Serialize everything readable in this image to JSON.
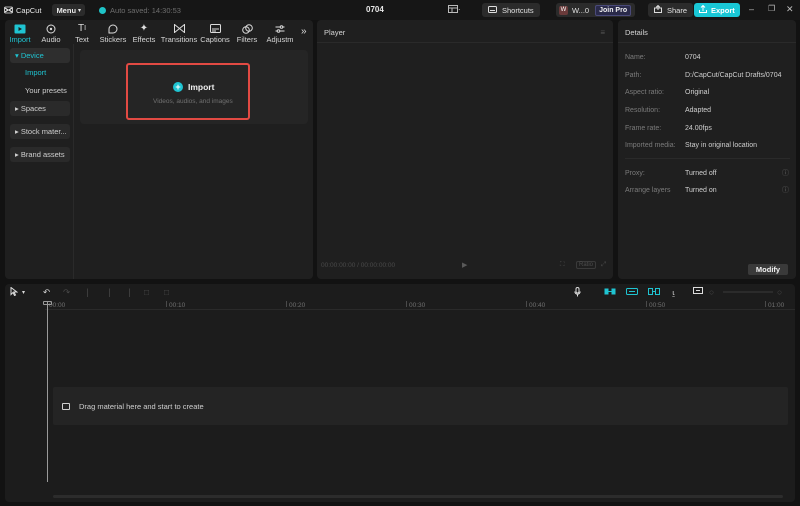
{
  "titlebar": {
    "app_name": "CapCut",
    "menu_label": "Menu",
    "autosave": "Auto saved: 14:30:53",
    "project_title": "0704",
    "shortcuts_label": "Shortcuts",
    "workspace_initial": "W",
    "workspace_name": "W...0",
    "join_pro_label": "Join Pro",
    "share_label": "Share",
    "export_label": "Export"
  },
  "tool_tabs": [
    {
      "label": "Import",
      "icon": "import-icon",
      "active": true
    },
    {
      "label": "Audio",
      "icon": "audio-icon"
    },
    {
      "label": "Text",
      "icon": "text-icon"
    },
    {
      "label": "Stickers",
      "icon": "stickers-icon"
    },
    {
      "label": "Effects",
      "icon": "effects-icon"
    },
    {
      "label": "Transitions",
      "icon": "transitions-icon"
    },
    {
      "label": "Captions",
      "icon": "captions-icon"
    },
    {
      "label": "Filters",
      "icon": "filters-icon"
    },
    {
      "label": "Adjustm",
      "icon": "adjustment-icon"
    }
  ],
  "sidebar": {
    "device": "▾ Device",
    "import": "Import",
    "your_presets": "Your presets",
    "spaces": "▸ Spaces",
    "stock_material": "▸ Stock mater...",
    "brand_assets": "▸ Brand assets"
  },
  "import_area": {
    "button_label": "Import",
    "subtitle": "Videos, audios, and images"
  },
  "player": {
    "title": "Player",
    "timecode": "00:00:00:00 / 00:00:00:00",
    "ratio_label": "Ratio"
  },
  "details": {
    "title": "Details",
    "rows": [
      {
        "label": "Name:",
        "value": "0704"
      },
      {
        "label": "Path:",
        "value": "D:/CapCut/CapCut Drafts/0704"
      },
      {
        "label": "Aspect ratio:",
        "value": "Original"
      },
      {
        "label": "Resolution:",
        "value": "Adapted"
      },
      {
        "label": "Frame rate:",
        "value": "24.00fps"
      },
      {
        "label": "Imported media:",
        "value": "Stay in original location"
      },
      {
        "label": "Proxy:",
        "value": "Turned off"
      },
      {
        "label": "Arrange layers",
        "value": "Turned on"
      }
    ],
    "modify_label": "Modify"
  },
  "timeline": {
    "ticks": [
      "00:00",
      "00:10",
      "00:20",
      "00:30",
      "00:40",
      "00:50",
      "01:00"
    ],
    "drop_hint": "Drag material here and start to create"
  },
  "colors": {
    "accent": "#1fc4d2",
    "highlight_border": "#e24a43",
    "export_bg": "#19c7d6"
  }
}
